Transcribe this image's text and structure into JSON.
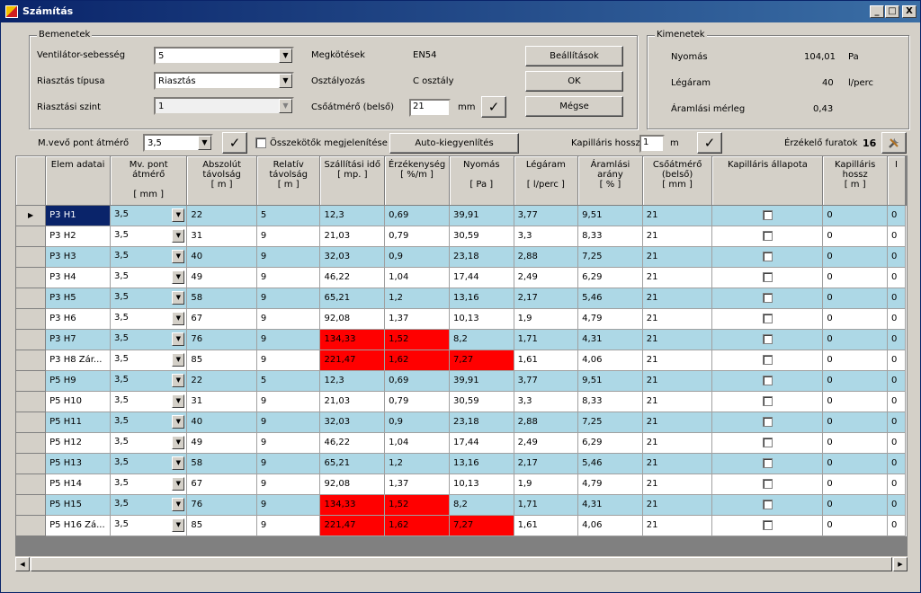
{
  "window": {
    "title": "Számítás",
    "min": "_",
    "max": "□",
    "close": "X"
  },
  "inputs": {
    "group_title": "Bemenetek",
    "fan_speed_label": "Ventilátor-sebesség",
    "fan_speed_value": "5",
    "alarm_type_label": "Riasztás típusa",
    "alarm_type_value": "Riasztás",
    "alarm_level_label": "Riasztási szint",
    "alarm_level_value": "1",
    "restrictions_label": "Megkötések",
    "restrictions_value": "EN54",
    "class_label": "Osztályozás",
    "class_value": "C osztály",
    "pipe_dia_label": "Csőátmérő (belső)",
    "pipe_dia_value": "21",
    "pipe_dia_unit": "mm",
    "settings_button": "Beállítások",
    "ok_button": "OK",
    "cancel_button": "Mégse"
  },
  "outputs": {
    "group_title": "Kimenetek",
    "pressure_label": "Nyomás",
    "pressure_value": "104,01",
    "pressure_unit": "Pa",
    "airflow_label": "Légáram",
    "airflow_value": "40",
    "airflow_unit": "l/perc",
    "balance_label": "Áramlási mérleg",
    "balance_value": "0,43"
  },
  "toolbar": {
    "sampling_dia_label": "M.vevő pont átmérő",
    "sampling_dia_value": "3,5",
    "show_connectors_label": "Összekötők megjelenítése",
    "autofill_button": "Auto-kiegyenlítés",
    "cap_len_label": "Kapilláris hossz",
    "cap_len_value": "1",
    "cap_len_unit": "m",
    "sensor_holes_label": "Érzékelő furatok",
    "sensor_holes_value": "16"
  },
  "icons": {
    "check": "✓",
    "dropdown": "▼",
    "row_marker": "▶",
    "tools": "tools-icon"
  },
  "colors": {
    "alt_row": "#add8e6",
    "alarm_cell": "#ff0000",
    "selection": "#0a246a"
  },
  "grid": {
    "headers": [
      [
        "Elem adatai"
      ],
      [
        "Mv. pont",
        "átmérő",
        "",
        "[ mm ]"
      ],
      [
        "Abszolút",
        "távolság",
        "[ m ]"
      ],
      [
        "Relatív",
        "távolság",
        "[ m ]"
      ],
      [
        "Szállítási idő",
        "[ mp. ]"
      ],
      [
        "Érzékenység",
        "[ %/m ]"
      ],
      [
        "Nyomás",
        "",
        "[ Pa ]"
      ],
      [
        "Légáram",
        "",
        "[ l/perc ]"
      ],
      [
        "Áramlási",
        "arány",
        "[ % ]"
      ],
      [
        "Csőátmérő",
        "(belső)",
        "[ mm ]"
      ],
      [
        "Kapilláris állapota"
      ],
      [
        "Kapilláris",
        "hossz",
        "[ m ]"
      ],
      [
        "I"
      ]
    ],
    "rows": [
      {
        "name": "P3  H1",
        "dia": "3,5",
        "abs": "22",
        "rel": "5",
        "time": "12,3",
        "sens": "0,69",
        "press": "39,91",
        "flow": "3,77",
        "ratio": "9,51",
        "pipe": "21",
        "caplen": "0",
        "last": "0"
      },
      {
        "name": "P3  H2",
        "dia": "3,5",
        "abs": "31",
        "rel": "9",
        "time": "21,03",
        "sens": "0,79",
        "press": "30,59",
        "flow": "3,3",
        "ratio": "8,33",
        "pipe": "21",
        "caplen": "0",
        "last": "0"
      },
      {
        "name": "P3  H3",
        "dia": "3,5",
        "abs": "40",
        "rel": "9",
        "time": "32,03",
        "sens": "0,9",
        "press": "23,18",
        "flow": "2,88",
        "ratio": "7,25",
        "pipe": "21",
        "caplen": "0",
        "last": "0"
      },
      {
        "name": "P3  H4",
        "dia": "3,5",
        "abs": "49",
        "rel": "9",
        "time": "46,22",
        "sens": "1,04",
        "press": "17,44",
        "flow": "2,49",
        "ratio": "6,29",
        "pipe": "21",
        "caplen": "0",
        "last": "0"
      },
      {
        "name": "P3  H5",
        "dia": "3,5",
        "abs": "58",
        "rel": "9",
        "time": "65,21",
        "sens": "1,2",
        "press": "13,16",
        "flow": "2,17",
        "ratio": "5,46",
        "pipe": "21",
        "caplen": "0",
        "last": "0"
      },
      {
        "name": "P3  H6",
        "dia": "3,5",
        "abs": "67",
        "rel": "9",
        "time": "92,08",
        "sens": "1,37",
        "press": "10,13",
        "flow": "1,9",
        "ratio": "4,79",
        "pipe": "21",
        "caplen": "0",
        "last": "0"
      },
      {
        "name": "P3  H7",
        "dia": "3,5",
        "abs": "76",
        "rel": "9",
        "time": "134,33",
        "sens": "1,52",
        "press": "8,2",
        "flow": "1,71",
        "ratio": "4,31",
        "pipe": "21",
        "caplen": "0",
        "last": "0"
      },
      {
        "name": "P3  H8  Zár...",
        "dia": "3,5",
        "abs": "85",
        "rel": "9",
        "time": "221,47",
        "sens": "1,62",
        "press": "7,27",
        "flow": "1,61",
        "ratio": "4,06",
        "pipe": "21",
        "caplen": "0",
        "last": "0"
      },
      {
        "name": "P5  H9",
        "dia": "3,5",
        "abs": "22",
        "rel": "5",
        "time": "12,3",
        "sens": "0,69",
        "press": "39,91",
        "flow": "3,77",
        "ratio": "9,51",
        "pipe": "21",
        "caplen": "0",
        "last": "0"
      },
      {
        "name": "P5  H10",
        "dia": "3,5",
        "abs": "31",
        "rel": "9",
        "time": "21,03",
        "sens": "0,79",
        "press": "30,59",
        "flow": "3,3",
        "ratio": "8,33",
        "pipe": "21",
        "caplen": "0",
        "last": "0"
      },
      {
        "name": "P5  H11",
        "dia": "3,5",
        "abs": "40",
        "rel": "9",
        "time": "32,03",
        "sens": "0,9",
        "press": "23,18",
        "flow": "2,88",
        "ratio": "7,25",
        "pipe": "21",
        "caplen": "0",
        "last": "0"
      },
      {
        "name": "P5  H12",
        "dia": "3,5",
        "abs": "49",
        "rel": "9",
        "time": "46,22",
        "sens": "1,04",
        "press": "17,44",
        "flow": "2,49",
        "ratio": "6,29",
        "pipe": "21",
        "caplen": "0",
        "last": "0"
      },
      {
        "name": "P5  H13",
        "dia": "3,5",
        "abs": "58",
        "rel": "9",
        "time": "65,21",
        "sens": "1,2",
        "press": "13,16",
        "flow": "2,17",
        "ratio": "5,46",
        "pipe": "21",
        "caplen": "0",
        "last": "0"
      },
      {
        "name": "P5  H14",
        "dia": "3,5",
        "abs": "67",
        "rel": "9",
        "time": "92,08",
        "sens": "1,37",
        "press": "10,13",
        "flow": "1,9",
        "ratio": "4,79",
        "pipe": "21",
        "caplen": "0",
        "last": "0"
      },
      {
        "name": "P5  H15",
        "dia": "3,5",
        "abs": "76",
        "rel": "9",
        "time": "134,33",
        "sens": "1,52",
        "press": "8,2",
        "flow": "1,71",
        "ratio": "4,31",
        "pipe": "21",
        "caplen": "0",
        "last": "0"
      },
      {
        "name": "P5  H16  Zá...",
        "dia": "3,5",
        "abs": "85",
        "rel": "9",
        "time": "221,47",
        "sens": "1,62",
        "press": "7,27",
        "flow": "1,61",
        "ratio": "4,06",
        "pipe": "21",
        "caplen": "0",
        "last": "0"
      }
    ],
    "alarm_cells": {
      "6": [
        "time",
        "sens"
      ],
      "7": [
        "time",
        "sens",
        "press"
      ],
      "14": [
        "time",
        "sens"
      ],
      "15": [
        "time",
        "sens",
        "press"
      ]
    }
  }
}
